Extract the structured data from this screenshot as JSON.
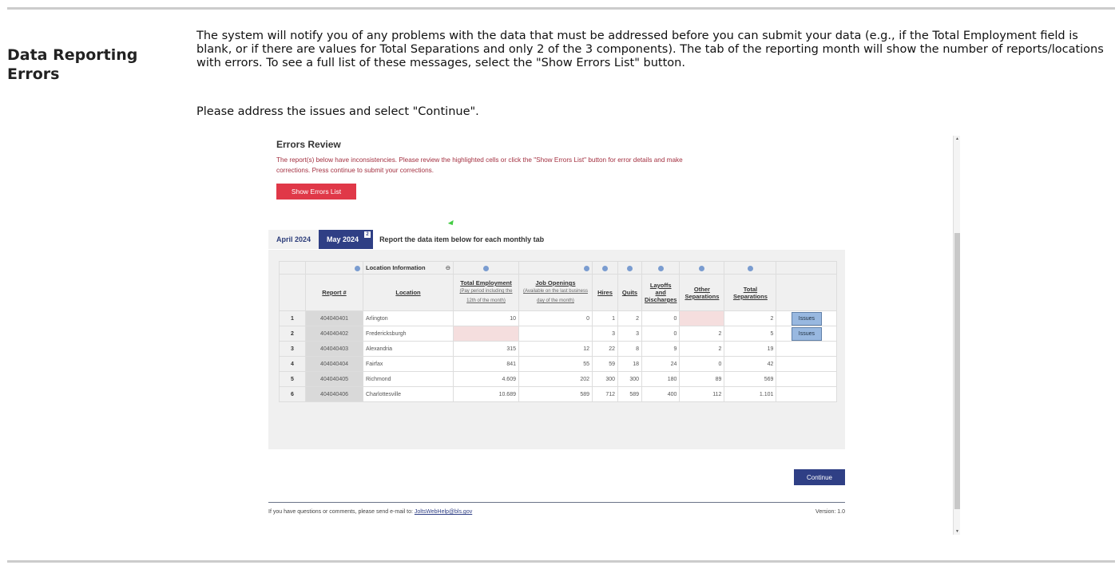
{
  "section": {
    "heading": "Data Reporting Errors",
    "intro": "The system will notify you of any problems with the data that must be addressed before you can submit your data (e.g., if the Total Employment field is blank, or if there are values for Total Separations and only 2 of the 3 components). The tab of the reporting month will show the number of reports/locations with errors. To see a full list of these messages, select the \"Show Errors List\" button.",
    "instruction": "Please address the issues and select \"Continue\"."
  },
  "screen": {
    "title": "Errors Review",
    "message": "The report(s) below have inconsistencies. Please review the highlighted cells or click the \"Show Errors List\" button for error details and make corrections. Press continue to submit your corrections.",
    "show_errors_label": "Show Errors List",
    "tabs": [
      {
        "label": "April 2024"
      },
      {
        "label": "May 2024",
        "badge": "2",
        "active": true
      }
    ],
    "tab_note": "Report the data item below for each monthly tab",
    "group_header": "Location Information",
    "columns": {
      "report": "Report #",
      "location": "Location",
      "te": "Total Employment",
      "te_sub": "(Pay period including the 12th of the month)",
      "jo": "Job Openings",
      "jo_sub": "(Available on the last business day of the month)",
      "hires": "Hires",
      "quits": "Quits",
      "layoffs": "Layoffs and Discharges",
      "other": "Other Separations",
      "total": "Total Separations"
    },
    "issues_label": "Issues",
    "rows": [
      {
        "n": "1",
        "report": "404040401",
        "location": "Arlington",
        "te": "10",
        "jo": "0",
        "hires": "1",
        "quits": "2",
        "layoffs": "0",
        "other": "",
        "total": "2",
        "err": [
          "other"
        ],
        "issues": true
      },
      {
        "n": "2",
        "report": "404040402",
        "location": "Fredericksburgh",
        "te": "",
        "jo": "",
        "hires": "3",
        "quits": "3",
        "layoffs": "0",
        "other": "2",
        "total": "5",
        "err": [
          "te"
        ],
        "issues": true
      },
      {
        "n": "3",
        "report": "404040403",
        "location": "Alexandria",
        "te": "315",
        "jo": "12",
        "hires": "22",
        "quits": "8",
        "layoffs": "9",
        "other": "2",
        "total": "19",
        "err": []
      },
      {
        "n": "4",
        "report": "404040404",
        "location": "Fairfax",
        "te": "841",
        "jo": "55",
        "hires": "59",
        "quits": "18",
        "layoffs": "24",
        "other": "0",
        "total": "42",
        "err": []
      },
      {
        "n": "5",
        "report": "404040405",
        "location": "Richmond",
        "te": "4.609",
        "jo": "202",
        "hires": "300",
        "quits": "300",
        "layoffs": "180",
        "other": "89",
        "total": "569",
        "err": []
      },
      {
        "n": "6",
        "report": "404040406",
        "location": "Charlottesville",
        "te": "10.689",
        "jo": "589",
        "hires": "712",
        "quits": "589",
        "layoffs": "400",
        "other": "112",
        "total": "1.101",
        "err": []
      }
    ],
    "continue_label": "Continue",
    "footer_text": "If you have questions or comments, please send e-mail to: ",
    "footer_email": "JoltsWebHelp@bls.gov",
    "version": "Version: 1.0",
    "colors": {
      "primary": "#2f3f85",
      "error_button": "#e03848",
      "error_cell": "#f5dede"
    }
  }
}
